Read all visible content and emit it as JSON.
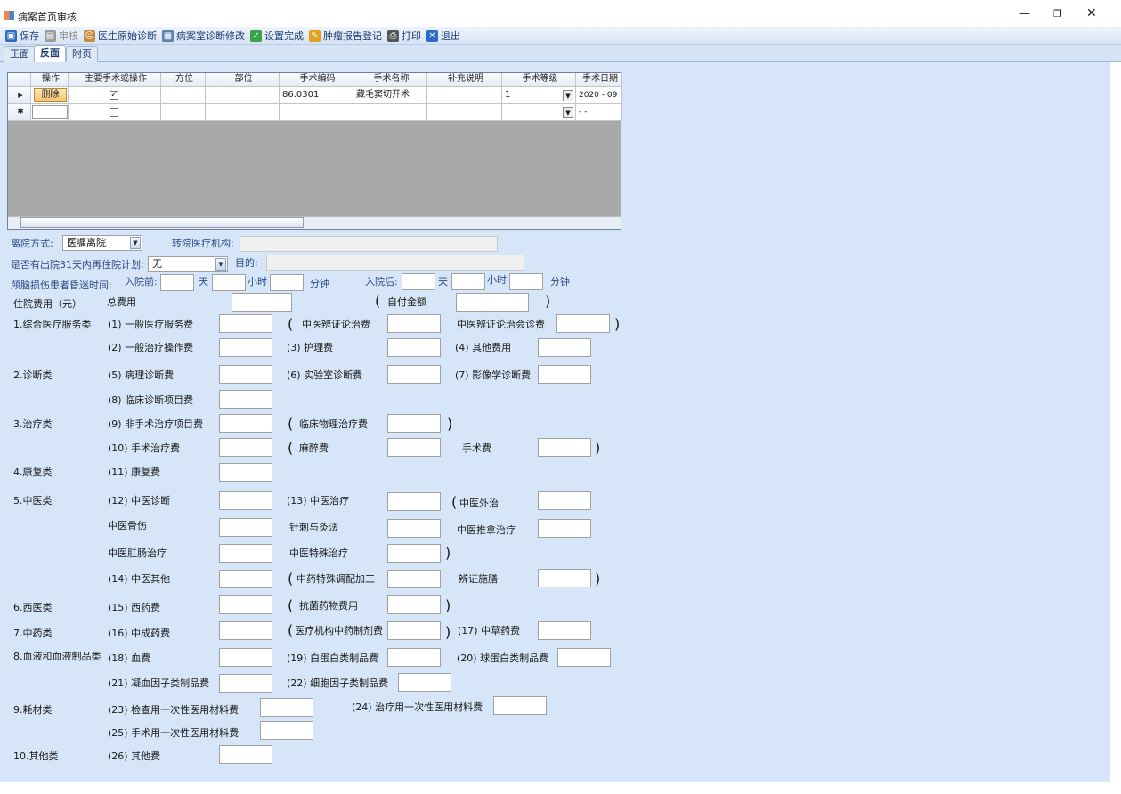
{
  "window": {
    "title": "病案首页审核"
  },
  "toolbar": [
    {
      "label": "保存",
      "icon": "save-icon",
      "enabled": true
    },
    {
      "label": "审核",
      "icon": "audit-icon",
      "enabled": false
    },
    {
      "label": "医生原始诊断",
      "icon": "doctor-icon",
      "enabled": true
    },
    {
      "label": "病案室诊断修改",
      "icon": "edit-record-icon",
      "enabled": true
    },
    {
      "label": "设置完成",
      "icon": "check-circle-icon",
      "enabled": true
    },
    {
      "label": "肿瘤报告登记",
      "icon": "pencil-icon",
      "enabled": true
    },
    {
      "label": "打印",
      "icon": "printer-icon",
      "enabled": true
    },
    {
      "label": "退出",
      "icon": "exit-icon",
      "enabled": true
    }
  ],
  "tabs": [
    {
      "label": "正面"
    },
    {
      "label": "反面",
      "active": true
    },
    {
      "label": "附页"
    }
  ],
  "grid": {
    "columns": [
      "操作",
      "主要手术或操作",
      "方位",
      "部位",
      "手术编码",
      "手术名称",
      "补充说明",
      "手术等级",
      "手术日期"
    ],
    "rows": [
      {
        "action": "删除",
        "main": true,
        "code": "86.0301",
        "name": "藏毛窦切开术",
        "grade": "1",
        "date": "2020 - 09"
      }
    ],
    "new_row_date": " -  -"
  },
  "discharge": {
    "mode_label": "离院方式:",
    "mode_value": "医嘱离院",
    "transfer_label": "转院医疗机构:",
    "readmit_label": "是否有出院31天内再住院计划:",
    "readmit_value": "无",
    "purpose_label": "目的:",
    "coma_label": "颅脑损伤患者昏迷时间:",
    "before_label": "入院前:",
    "after_label": "入院后:",
    "day": "天",
    "hour": "小时",
    "minute": "分钟"
  },
  "fees": {
    "title": "住院费用（元）",
    "total_label": "总费用",
    "self_pay_label": "自付金额",
    "paren_open": "(",
    "paren_close": ")",
    "labels": [
      "1.综合医疗服务类",
      "(1) 一般医疗服务费",
      "中医辨证论治费",
      "中医辨证论治会诊费",
      "(2) 一般治疗操作费",
      "(3) 护理费",
      "(4) 其他费用",
      "2.诊断类",
      "(5) 病理诊断费",
      "(6) 实验室诊断费",
      "(7) 影像学诊断费",
      "(8) 临床诊断项目费",
      "3.治疗类",
      "(9) 非手术治疗项目费",
      "临床物理治疗费",
      "(10) 手术治疗费",
      "麻醉费",
      "手术费",
      "4.康复类",
      "(11) 康复费",
      "5.中医类",
      "(12) 中医诊断",
      "(13) 中医治疗",
      "中医外治",
      "中医骨伤",
      "针刺与灸法",
      "中医推拿治疗",
      "中医肛肠治疗",
      "中医特殊治疗",
      "(14) 中医其他",
      "中药特殊调配加工",
      "辨证施膳",
      "6.西医类",
      "(15) 西药费",
      "抗菌药物费用",
      "7.中药类",
      "(16) 中成药费",
      "医疗机构中药制剂费",
      "(17) 中草药费",
      "8.血液和血液制品类",
      "(18) 血费",
      "(19) 白蛋白类制品费",
      "(20) 球蛋白类制品费",
      "(21) 凝血因子类制品费",
      "(22) 细胞因子类制品费",
      "9.耗材类",
      "(23) 检查用一次性医用材料费",
      "(24) 治疗用一次性医用材料费",
      "(25) 手术用一次性医用材料费",
      "10.其他类",
      "(26) 其他费"
    ]
  }
}
